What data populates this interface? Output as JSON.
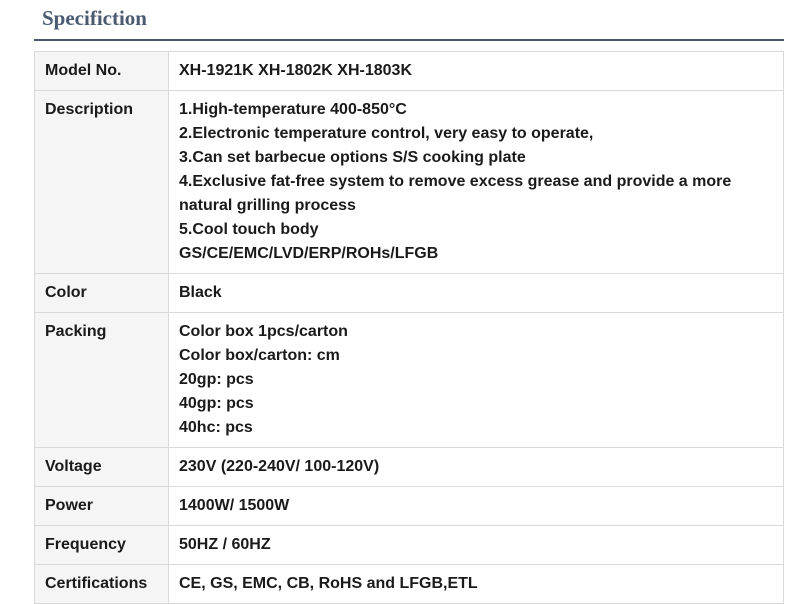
{
  "title": "Specifiction",
  "rows": [
    {
      "label": "Model No.",
      "lines": [
        "XH-1921K XH-1802K XH-1803K"
      ]
    },
    {
      "label": "Description",
      "lines": [
        "1.High-temperature 400-850°C",
        "2.Electronic temperature control, very easy to operate,",
        "3.Can set barbecue options S/S cooking plate",
        "4.Exclusive fat-free system to remove excess grease and provide a more natural grilling process",
        "5.Cool touch body",
        "GS/CE/EMC/LVD/ERP/ROHs/LFGB"
      ]
    },
    {
      "label": "Color",
      "lines": [
        "Black"
      ]
    },
    {
      "label": "Packing",
      "lines": [
        "Color box 1pcs/carton",
        "Color box/carton: cm",
        "20gp: pcs",
        "40gp: pcs",
        "40hc: pcs"
      ]
    },
    {
      "label": "Voltage",
      "lines": [
        "230V (220-240V/ 100-120V)"
      ]
    },
    {
      "label": "Power",
      "lines": [
        "1400W/ 1500W"
      ]
    },
    {
      "label": "Frequency",
      "lines": [
        "50HZ / 60HZ"
      ]
    },
    {
      "label": "Certifications",
      "lines": [
        "CE, GS, EMC, CB, RoHS and LFGB,ETL"
      ]
    }
  ]
}
